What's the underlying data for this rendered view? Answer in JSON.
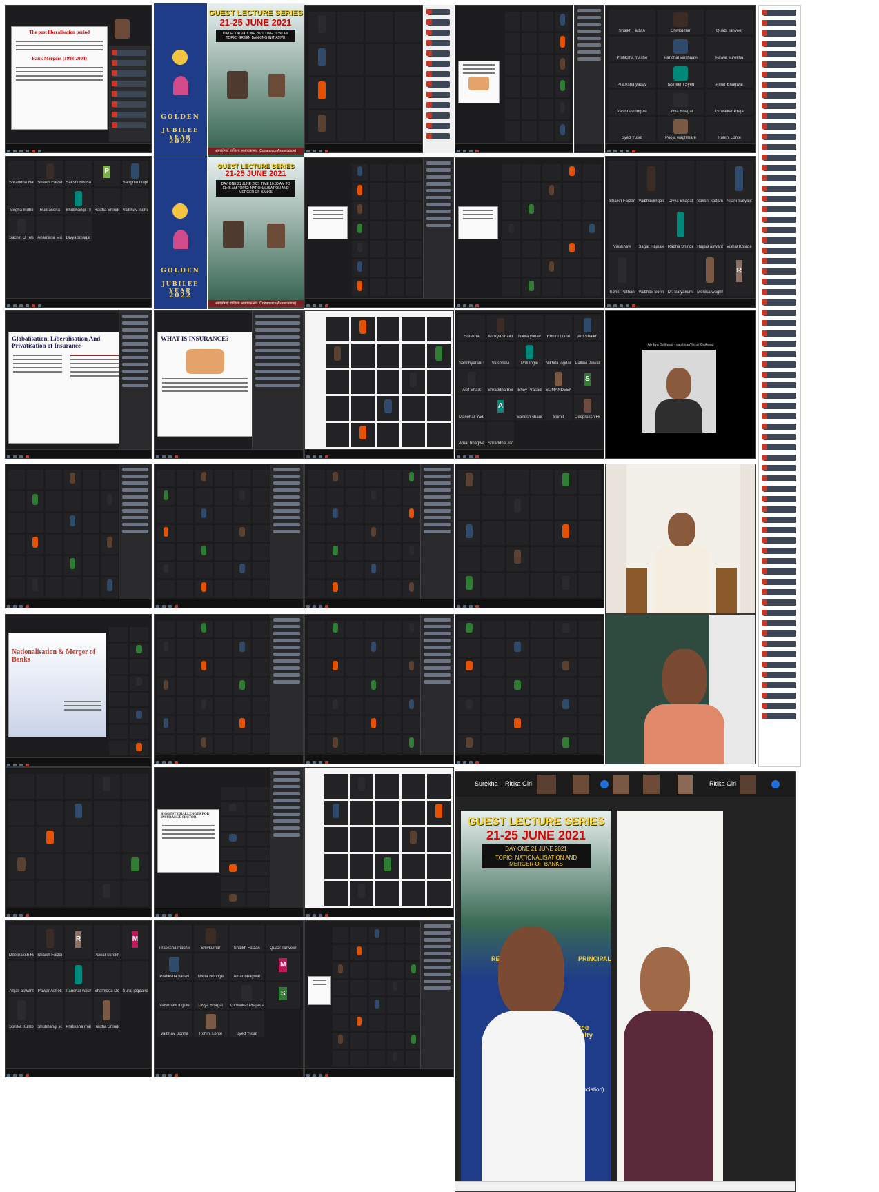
{
  "posters": {
    "series_title": "GUEST LECTURE SERIES",
    "dates": "21-25 JUNE 2021",
    "topic_day2": "DAY FOUR  24 JUNE 2021  TIME 10:30 AM  TOPIC: GREEN BANKING INITIATIVE",
    "topic_day1": "DAY ONE  21 JUNE 2021  TIME 10:30 AM TO 11:45 AM  TOPIC: NATIONALISATION AND MERGER OF BANKS",
    "jubilee": [
      "GOLDEN",
      "JUBILEE YEAR",
      "2022"
    ],
    "footer": "अंबाजोगाई वाणिज्य अध्यापक संघ (Commerce Association)",
    "big_day": "DAY ONE  21 JUNE 2021",
    "big_topic": "TOPIC: NATIONALISATION AND MERGER OF BANKS",
    "big_resource": "RESOU",
    "big_principal": "PRINCIPAL",
    "big_commerce": "merce Faculty",
    "big_assoc": "Association)"
  },
  "slides": {
    "liberalisation": "The post liberalisation period",
    "bank_mergers": "Bank Mergers (1993-2004)",
    "glp": "Globalisation, Liberalisation And Privatisation of Insurance",
    "what_is_insurance": "WHAT IS INSURANCE?",
    "nationalisation": "Nationalisation & Merger of Banks",
    "challenges": "BIGGEST CHALLENGES FOR INSURANCE SECTOR"
  },
  "bottom_right_bar": {
    "names": [
      "Surekha",
      "Ritika Giri",
      "Ritika Giri"
    ]
  },
  "participants_a": [
    "Shaikh Faizan",
    "Shivkumar",
    "Quazi Tanveer",
    "Pratiksha mashe",
    "Panchal vaishnavi",
    "Pawar surekha",
    "Pratiksha yadav",
    "Tasneem Syed",
    "Amar Bhagwat",
    "Vaishnavi Ingole",
    "Divya Bhagat",
    "Girwalkar Praja",
    "Syed Yusuf",
    "Pooja waghmare",
    "Rohini Lonte"
  ],
  "participants_b": [
    "Shaikh Faizan",
    "Vaibhavlingole",
    "Divya Bhagat",
    "Sakshi kadam",
    "Nilam Satyajit",
    "Vaishnavi",
    "Sagar Rajnale",
    "Radha Shinde",
    "Rajpal aswant",
    "Vishal Kolade",
    "Sohel Pathan",
    "Vaibhav Sonna",
    "Dr. Satyakumar",
    "Monika waghm",
    "R"
  ],
  "participants_c": [
    "Surekha",
    "Ajinkya shaikh",
    "Nikita yadav",
    "Rohini Lonte",
    "Arif Shaikh",
    "Sandhyarani w",
    "Vaishnavi",
    "Priti Ingle",
    "Nikhita jogdand",
    "Pallavi Pawar",
    "Asif Shaik",
    "Shraddha Beni",
    "Bhoy Prasad",
    "SUMANDEEN AB",
    "S",
    "Manohar Yadav",
    "A",
    "Sanesh chaudhri",
    "Sumit",
    "Deepraksh Her",
    "Amar bhagwat",
    "Shraddha Jadh"
  ],
  "participants_d": [
    "Deepraksh Har",
    "Shaikh Faizan",
    "R",
    "Pawar surekha",
    "M",
    "Anjali aswant",
    "Pawar Ashok",
    "Panchal vaishnavi",
    "Shamlada Desk",
    "Suraj jogdand",
    "Sonika Kumbhar",
    "Shubhangi sola",
    "Pratiksha mashe",
    "Radha Shinde"
  ],
  "participants_e": [
    "Pratiksha mashe",
    "Shivkumar",
    "Shaikh Faizan",
    "Quazi Tanveer",
    "Pratiksha yadav",
    "Nikita Bondge",
    "Amar bhagwat",
    "M",
    "Vaishnavi Ingole",
    "Divya Bhagat",
    "Girwalkar Prajakta",
    "S",
    "Vaibhav Sonna",
    "Rohini Lonte",
    "Syed Yusuf"
  ],
  "participants_f": [
    "Shraddha Nair",
    "Shaikh Faizan",
    "Sakshi Bhosale",
    "P",
    "Sangma Gupta",
    "Megha Indhe",
    "Rudrasena",
    "Shubhangi Tharse",
    "Radha Shinde",
    "Vaibhav Indhe",
    "Sachin D Tekale",
    "Anamaria Mundhe",
    "Divya Bhagat"
  ],
  "single_video_caption": "Ajinkya Gaikwad - vaishnaaVishal Gaikwad"
}
